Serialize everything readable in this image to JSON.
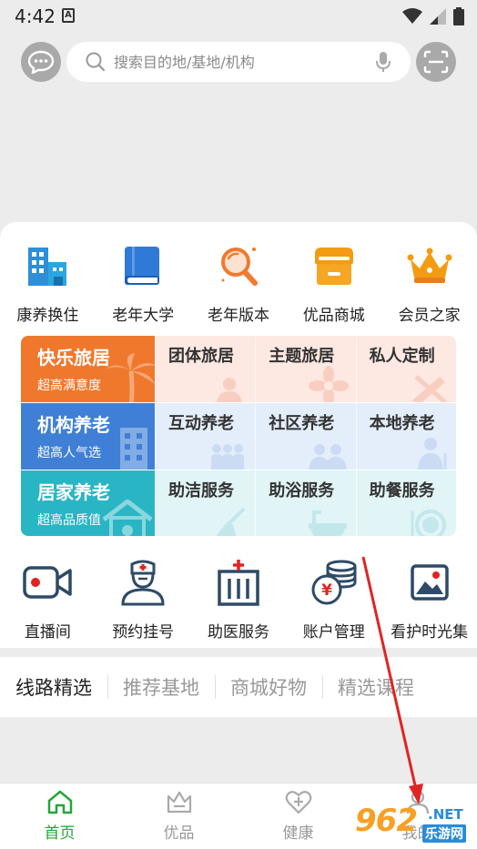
{
  "status_bar": {
    "time": "4:42",
    "notif_letter": "A"
  },
  "search": {
    "placeholder": "搜索目的地/基地/机构"
  },
  "top_icons": [
    {
      "label": "康养换住",
      "icon": "buildings-icon"
    },
    {
      "label": "老年大学",
      "icon": "book-icon"
    },
    {
      "label": "老年版本",
      "icon": "magnifier-icon"
    },
    {
      "label": "优品商城",
      "icon": "shop-icon"
    },
    {
      "label": "会员之家",
      "icon": "crown-icon"
    }
  ],
  "matrix": [
    {
      "title": "快乐旅居",
      "subtitle": "超高满意度",
      "color": "#f0782d",
      "items": [
        "团体旅居",
        "主题旅居",
        "私人定制"
      ]
    },
    {
      "title": "机构养老",
      "subtitle": "超高人气选",
      "color": "#3f7fd6",
      "items": [
        "互动养老",
        "社区养老",
        "本地养老"
      ]
    },
    {
      "title": "居家养老",
      "subtitle": "超高品质值",
      "color": "#2ab5c4",
      "items": [
        "助洁服务",
        "助浴服务",
        "助餐服务"
      ]
    }
  ],
  "services": [
    {
      "label": "直播间",
      "icon": "video-camera-icon"
    },
    {
      "label": "预约挂号",
      "icon": "nurse-icon"
    },
    {
      "label": "助医服务",
      "icon": "hospital-icon"
    },
    {
      "label": "账户管理",
      "icon": "coins-icon"
    },
    {
      "label": "看护时光集",
      "icon": "photo-icon"
    }
  ],
  "tabs": [
    "线路精选",
    "推荐基地",
    "商城好物",
    "精选课程"
  ],
  "bottom_nav": [
    {
      "label": "首页",
      "icon": "home-icon",
      "active": true
    },
    {
      "label": "优品",
      "icon": "basket-icon",
      "active": false
    },
    {
      "label": "健康",
      "icon": "heart-plus-icon",
      "active": false
    },
    {
      "label": "我的",
      "icon": "user-icon",
      "active": false
    }
  ],
  "watermark": {
    "brand": "962",
    "suffix": ".NET",
    "sub": "乐游网"
  },
  "colors": {
    "accent_green": "#26a43a",
    "icon_dark": "#2e4a66"
  }
}
